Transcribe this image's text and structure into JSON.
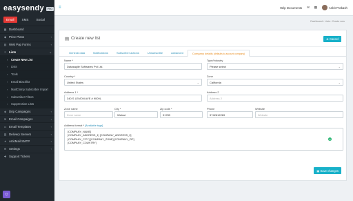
{
  "brand": {
    "name": "easysendy",
    "badge": "PRO"
  },
  "sidebar": {
    "tabs": [
      "Email",
      "SMS",
      "Social"
    ],
    "items": [
      {
        "label": "Dashboard",
        "icon": "dashboard-icon"
      },
      {
        "label": "Price Plans",
        "icon": "tag-icon"
      },
      {
        "label": "Web Pop Forms",
        "icon": "form-icon"
      },
      {
        "label": "Lists",
        "icon": "list-icon"
      }
    ],
    "lists_sub": [
      "Create New List",
      "Lists",
      "Tools",
      "Email Blacklist",
      "MailChimp Subscriber Import",
      "Subscriber Filters",
      "Suppression Lists"
    ],
    "items_after": [
      {
        "label": "Drip Campaigns"
      },
      {
        "label": "Email Campaigns"
      },
      {
        "label": "Email Templates"
      },
      {
        "label": "Delivery Servers"
      },
      {
        "label": "ArticMail SMTP"
      },
      {
        "label": "Settings"
      },
      {
        "label": "Support Tickets"
      }
    ]
  },
  "topbar": {
    "help": "Help Documents",
    "user": "Ankit Prakash"
  },
  "breadcrumb": "Dashboard  ›  Lists  ›  Create new",
  "card": {
    "title": "Create new list",
    "cancel": "Cancel",
    "tabs": [
      "General data",
      "Notifications",
      "Subscriber actions",
      "Unsubscribe",
      "Advanced"
    ],
    "active_tab": "Company details",
    "active_tab_note": "(defaults to account company)",
    "save": "Save changes"
  },
  "form": {
    "name_label": "Name *",
    "name_value": "Datasagile Softwares Pvt Ltd.",
    "type_label": "Type/Industry",
    "type_value": "Please select",
    "country_label": "Country *",
    "country_value": "United States",
    "zone_label": "Zone",
    "zone_value": "California",
    "addr1_label": "Address 1 *",
    "addr1_value": "340 S LEMON AVE # 9009L",
    "addr2_label": "Address 2",
    "addr2_placeholder": "Address 2",
    "zonename_label": "Zone name",
    "zonename_placeholder": "Zone name",
    "city_label": "City *",
    "city_value": "Walnut",
    "zip_label": "Zip code *",
    "zip_value": "91789",
    "phone_label": "Phone",
    "phone_value": "9742612269",
    "website_label": "Website",
    "website_placeholder": "Website",
    "format_label": "Address format *",
    "format_link": "[Available tags]",
    "format_lines": [
      "[COMPANY_NAME]",
      "[COMPANY_ADDRESS_1] [COMPANY_ADDRESS_2]",
      "[COMPANY_CITY] [COMPANY_ZONE] [COMPANY_ZIP]",
      "[COMPANY_COUNTRY]"
    ]
  }
}
